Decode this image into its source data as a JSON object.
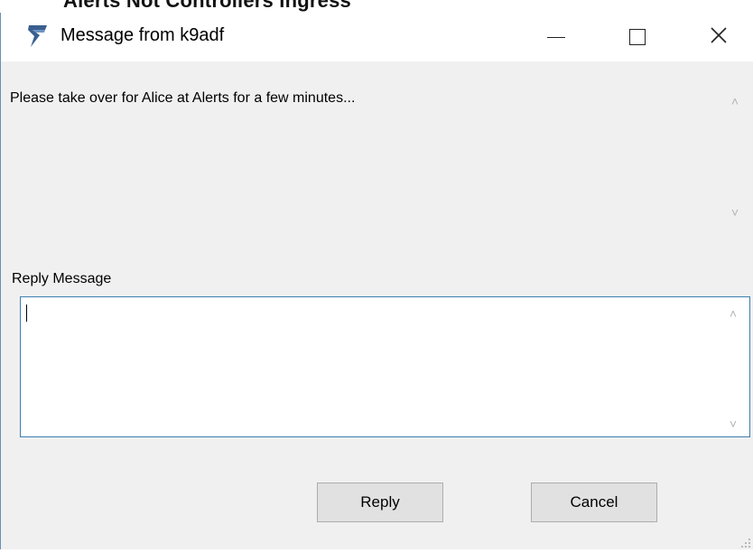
{
  "background": {
    "partial_text": "Alerts Not Controllers  Ingress  "
  },
  "window": {
    "title": "Message from k9adf",
    "icon": "app-logo-icon",
    "controls": {
      "minimize_icon": "minimize-icon",
      "maximize_icon": "maximize-icon",
      "close_symbol": "✕"
    }
  },
  "message": {
    "text": "Please take over for Alice at Alerts for a few minutes..."
  },
  "reply": {
    "label": "Reply Message",
    "value": "",
    "placeholder": ""
  },
  "buttons": {
    "reply": "Reply",
    "cancel": "Cancel"
  },
  "scroll_arrows": {
    "up": "˄",
    "down": "˅"
  },
  "colors": {
    "input_border": "#3c7fb1",
    "window_bg": "#f0f0f0",
    "button_bg": "#e1e1e1"
  }
}
